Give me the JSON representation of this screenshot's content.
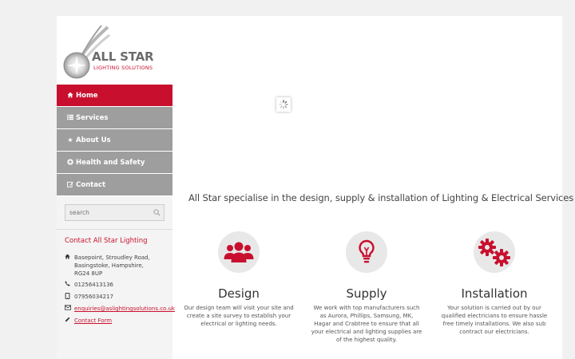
{
  "brand": {
    "name": "ALL STAR",
    "subtitle": "LIGHTING SOLUTIONS",
    "accent_color": "#c8102e",
    "nav_color": "#9e9e9e"
  },
  "nav": {
    "items": [
      {
        "label": "Home",
        "icon": "home-icon",
        "active": true
      },
      {
        "label": "Services",
        "icon": "list-icon",
        "active": false
      },
      {
        "label": "About Us",
        "icon": "star-icon",
        "active": false
      },
      {
        "label": "Health and Safety",
        "icon": "plus-circle-icon",
        "active": false
      },
      {
        "label": "Contact",
        "icon": "edit-icon",
        "active": false
      }
    ]
  },
  "search": {
    "placeholder": "search"
  },
  "contact": {
    "title": "Contact All Star Lighting",
    "address_line1": "Basepoint, Stroudley Road,",
    "address_line2": "Basingstoke, Hampshire,",
    "address_line3": "RG24 8UP",
    "phone": "01256413136",
    "mobile": "07956034217",
    "email": "enquiries@aslightingsolutions.co.uk",
    "form_link": "Contact Form"
  },
  "main": {
    "tagline": "All Star specialise in the design, supply & installation of Lighting & Electrical Services",
    "features": [
      {
        "icon": "users-icon",
        "title": "Design",
        "text": "Our design team will visit your site and create a site survey to establish your electrical or lighting needs."
      },
      {
        "icon": "lightbulb-icon",
        "title": "Supply",
        "text": "We work with top manufacturers such as Aurora, Phillips, Samsung, MK, Hagar and Crabtree to ensure that all your electrical and lighting supplies are of the highest quality."
      },
      {
        "icon": "cogs-icon",
        "title": "Installation",
        "text": "Your solution is carried out by our qualified electricians to ensure hassle free timely installations. We also sub contract our electricians."
      }
    ]
  }
}
